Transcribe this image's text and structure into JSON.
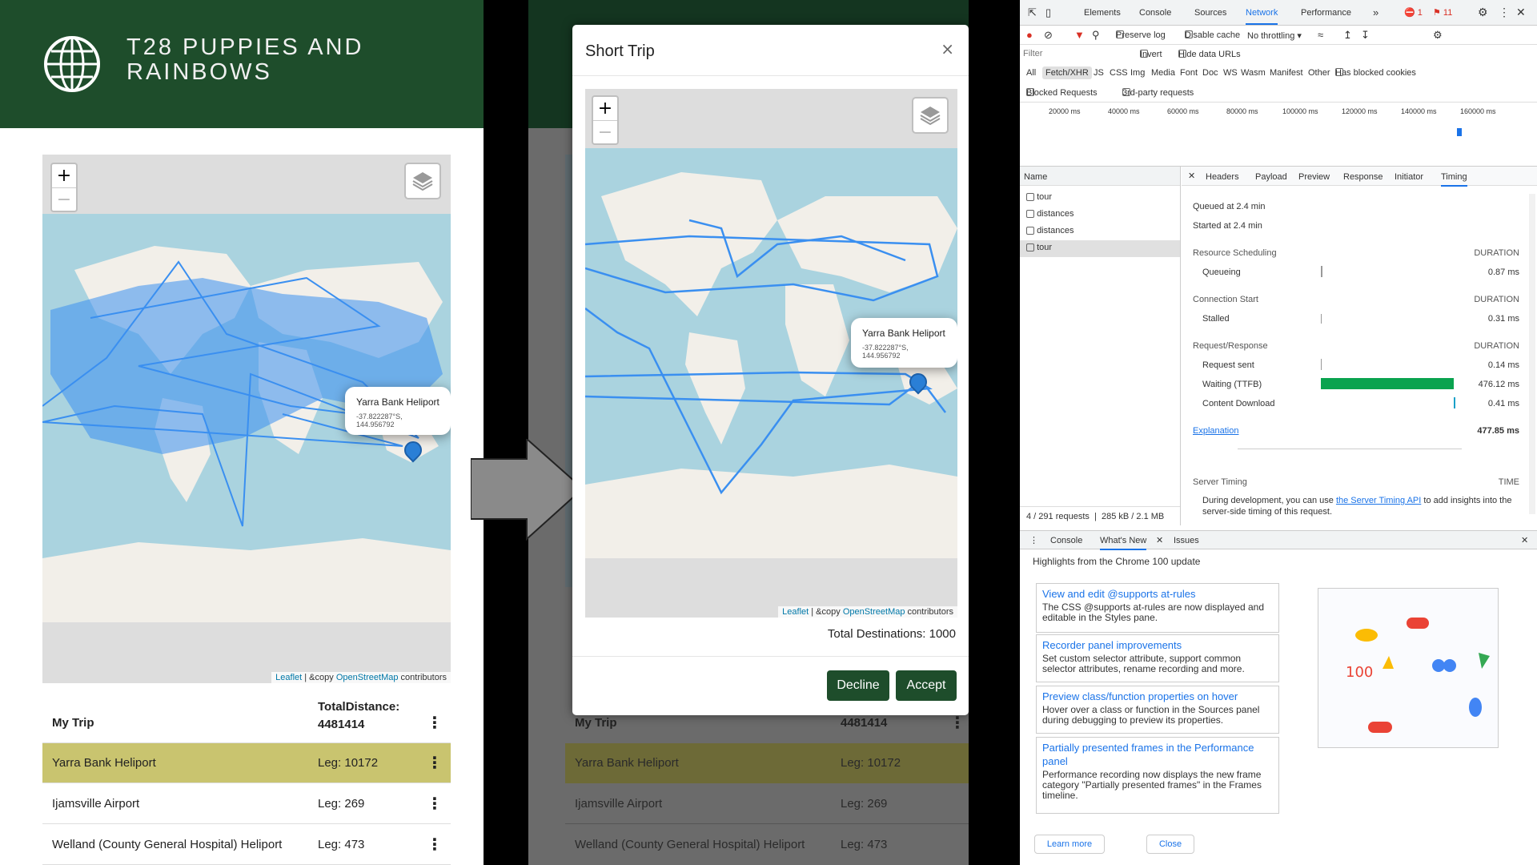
{
  "left_app": {
    "title": "T28 PUPPIES AND RAINBOWS",
    "map": {
      "zoom_in": "+",
      "zoom_out": "−",
      "popup_title": "Yarra Bank Heliport",
      "popup_coords": "-37.822287°S, 144.956792",
      "attribution_leaflet": "Leaflet",
      "attribution_rest": " | &copy ",
      "attribution_osm": "OpenStreetMap",
      "attribution_tail": " contributors"
    },
    "trip": {
      "label": "My Trip",
      "total_label": "TotalDistance:",
      "total_value": "4481414",
      "rows": [
        {
          "name": "Yarra Bank Heliport",
          "leg": "Leg: 10172"
        },
        {
          "name": "Ijamsville Airport",
          "leg": "Leg: 269"
        },
        {
          "name": "Welland (County General Hospital) Heliport",
          "leg": "Leg: 473"
        }
      ]
    },
    "colors": {
      "header": "#1e4d2b",
      "highlight": "#c9c46f",
      "route": "#3a8ff0"
    }
  },
  "modal": {
    "title": "Short Trip",
    "close": "×",
    "zoom_in": "+",
    "zoom_out": "−",
    "popup_title": "Yarra Bank Heliport",
    "popup_coords": "-37.822287°S, 144.956792",
    "attribution_leaflet": "Leaflet",
    "attribution_rest": " | &copy ",
    "attribution_osm": "OpenStreetMap",
    "attribution_tail": " contributors",
    "total_destinations": "Total Destinations: 1000",
    "decline": "Decline",
    "accept": "Accept",
    "behind": {
      "trip_label": "My Trip",
      "total_value": "4481414",
      "rows": [
        {
          "name": "Yarra Bank Heliport",
          "leg": "Leg: 10172"
        },
        {
          "name": "Ijamsville Airport",
          "leg": "Leg: 269"
        },
        {
          "name": "Welland (County General Hospital) Heliport",
          "leg": "Leg: 473"
        }
      ]
    }
  },
  "devtools": {
    "tabs": [
      "Elements",
      "Console",
      "Sources",
      "Network",
      "Performance",
      "»"
    ],
    "active_tab": "Network",
    "error_count": "1",
    "issue_count": "11",
    "toolbar": {
      "preserve_log": "Preserve log",
      "disable_cache": "Disable cache",
      "throttling": "No throttling"
    },
    "filter_placeholder": "Filter",
    "invert": "Invert",
    "hide_data_urls": "Hide data URLs",
    "type_filters": [
      "All",
      "Fetch/XHR",
      "JS",
      "CSS",
      "Img",
      "Media",
      "Font",
      "Doc",
      "WS",
      "Wasm",
      "Manifest",
      "Other"
    ],
    "has_blocked_cookies": "Has blocked cookies",
    "blocked_requests": "Blocked Requests",
    "third_party": "3rd-party requests",
    "timeline_ticks": [
      "20000 ms",
      "40000 ms",
      "60000 ms",
      "80000 ms",
      "100000 ms",
      "120000 ms",
      "140000 ms",
      "160000 ms"
    ],
    "name_header": "Name",
    "requests": [
      "tour",
      "distances",
      "distances",
      "tour"
    ],
    "detail_tabs": [
      "Headers",
      "Payload",
      "Preview",
      "Response",
      "Initiator",
      "Timing"
    ],
    "active_detail_tab": "Timing",
    "queued": "Queued at 2.4 min",
    "started": "Started at 2.4 min",
    "sections": {
      "resource_scheduling": "Resource Scheduling",
      "connection_start": "Connection Start",
      "request_response": "Request/Response",
      "duration": "DURATION"
    },
    "timing": {
      "queueing": {
        "label": "Queueing",
        "value": "0.87 ms"
      },
      "stalled": {
        "label": "Stalled",
        "value": "0.31 ms"
      },
      "request_sent": {
        "label": "Request sent",
        "value": "0.14 ms"
      },
      "waiting": {
        "label": "Waiting (TTFB)",
        "value": "476.12 ms"
      },
      "content_download": {
        "label": "Content Download",
        "value": "0.41 ms"
      }
    },
    "explanation": "Explanation",
    "total": "477.85 ms",
    "server_timing": "Server Timing",
    "time_header": "TIME",
    "server_text_1": "During development, you can use ",
    "server_link": "the Server Timing API",
    "server_text_2": " to add insights",
    "server_text_3": "into the server-side timing of this request.",
    "status_requests": "4 / 291 requests",
    "status_size": "285 kB / 2.1 MB",
    "drawer_tabs": [
      "Console",
      "What's New",
      "Issues"
    ],
    "drawer_active": "What's New",
    "highlights": "Highlights from the Chrome 100 update",
    "cards": [
      {
        "title": "View and edit @supports at-rules",
        "desc": "The CSS @supports at-rules are now displayed and editable in the Styles pane."
      },
      {
        "title": "Recorder panel improvements",
        "desc": "Set custom selector attribute, support common selector attributes, rename recording and more."
      },
      {
        "title": "Preview class/function properties on hover",
        "desc": "Hover over a class or function in the Sources panel during debugging to preview its properties."
      },
      {
        "title": "Partially presented frames in the Performance panel",
        "desc": "Performance recording now displays the new frame category \"Partially presented frames\" in the Frames timeline."
      }
    ],
    "learn_more": "Learn more",
    "close": "Close"
  }
}
